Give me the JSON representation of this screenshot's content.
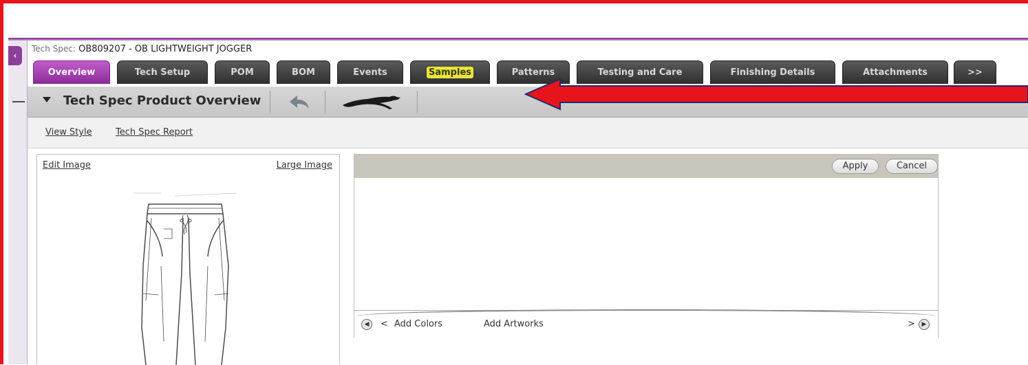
{
  "spec": {
    "label": "Tech Spec:",
    "value": "OB809207 - OB LIGHTWEIGHT JOGGER"
  },
  "tabs": [
    {
      "label": "Overview",
      "active": true
    },
    {
      "label": "Tech Setup"
    },
    {
      "label": "POM"
    },
    {
      "label": "BOM"
    },
    {
      "label": "Events"
    },
    {
      "label": "Samples",
      "highlighted": true
    },
    {
      "label": "Patterns"
    },
    {
      "label": "Testing and Care"
    },
    {
      "label": "Finishing Details"
    },
    {
      "label": "Attachments"
    },
    {
      "label": ">>"
    }
  ],
  "section": {
    "title": "Tech Spec Product Overview",
    "icons": [
      "back-arrow-icon",
      "panther-logo-icon"
    ]
  },
  "links": {
    "view_style": "View Style",
    "tech_spec_report": "Tech Spec Report"
  },
  "image_panel": {
    "edit_image": "Edit Image",
    "large_image": "Large Image"
  },
  "colorways_panel": {
    "apply": "Apply",
    "cancel": "Cancel",
    "prev_marker": "<",
    "add_colors": "Add Colors",
    "add_artworks": "Add Artworks",
    "next_marker": ">"
  },
  "colors": {
    "accent_purple": "#8a2c98",
    "tab_dark": "#3a3a3a",
    "highlight_yellow": "#e9e43a",
    "annotation_red": "#e8141b"
  }
}
